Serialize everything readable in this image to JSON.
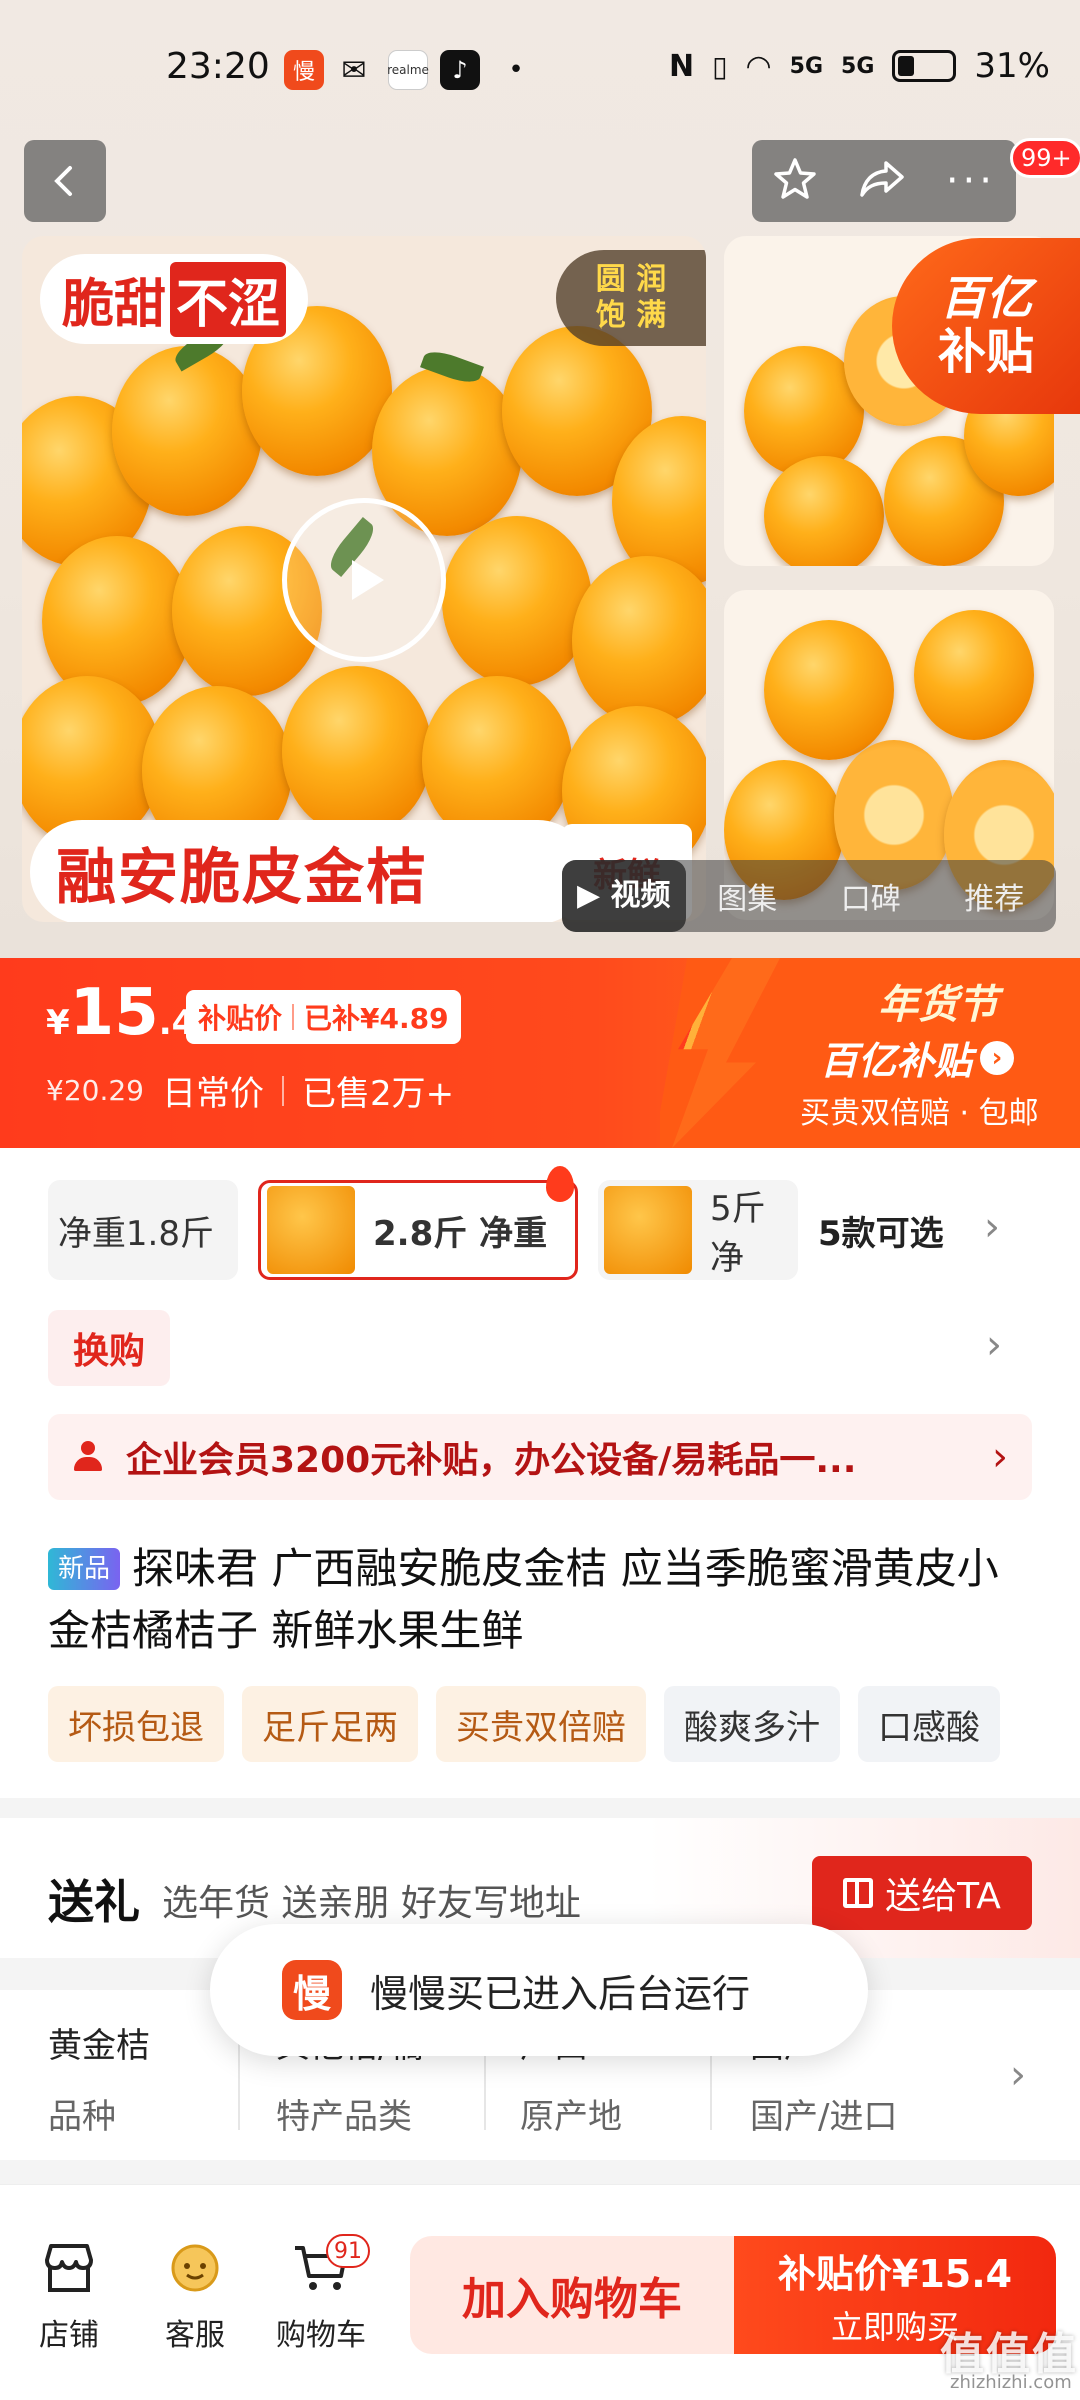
{
  "status_bar": {
    "time": "23:20",
    "app_badges": [
      "慢",
      "realme"
    ],
    "battery": "31%",
    "network": [
      "5G",
      "5G"
    ]
  },
  "topbar": {
    "back_icon": "chevron-left-icon",
    "badge_count": "99+"
  },
  "gallery": {
    "tag_left_a": "脆甜",
    "tag_left_b": "不涩",
    "tag_right_l1": "圆 润",
    "tag_right_l2": "饱 满",
    "banner": "融安脆皮金桔",
    "banner_tail": "新鲜",
    "corner_l1": "百亿",
    "corner_l2": "补贴",
    "tabs": [
      "视频",
      "图集",
      "口碑",
      "推荐"
    ],
    "active_tab": "视频"
  },
  "price": {
    "symbol": "¥",
    "integer": "15",
    "decimal": ".4",
    "tag_label": "补贴价",
    "tag_saved": "已补¥4.89",
    "original": "¥20.29",
    "daily_label": "日常价",
    "sold": "已售2万+"
  },
  "promo": {
    "festival": "年货节",
    "subsidy": "百亿补贴",
    "note": "买贵双倍赔 · 包邮"
  },
  "specs": {
    "options": [
      {
        "label": "净重1.8斤",
        "selected": false
      },
      {
        "label": "2.8斤 净重",
        "selected": true
      },
      {
        "label": "5斤 净",
        "selected": false
      }
    ],
    "count_label": "5款可选"
  },
  "exchange_label": "换购",
  "vip_text": "企业会员3200元补贴，办公设备/易耗品一...",
  "product": {
    "new_tag": "新品",
    "title": "探味君 广西融安脆皮金桔 应当季脆蜜滑黄皮小金桔橘桔子 新鲜水果生鲜"
  },
  "service_tags": [
    "坏损包退",
    "足斤足两",
    "买贵双倍赔",
    "酸爽多汁",
    "口感酸"
  ],
  "gift": {
    "title": "送礼",
    "subtitle": "选年货 送亲朋 好友写地址",
    "button": "送给TA"
  },
  "attributes": [
    {
      "value": "黄金桔",
      "key": "品种"
    },
    {
      "value": "其他桔/橘",
      "key": "特产品类"
    },
    {
      "value": "广西",
      "key": "原产地"
    },
    {
      "value": "国产",
      "key": "国产/进口"
    }
  ],
  "toast": {
    "icon_text": "慢",
    "text": "慢慢买已进入后台运行"
  },
  "bottom_nav": {
    "shop": "店铺",
    "service": "客服",
    "cart": "购物车",
    "cart_count": "91",
    "add_to_cart": "加入购物车",
    "buy_l1": "补贴价¥15.4",
    "buy_l2": "立即购买"
  },
  "watermark": {
    "main": "值值值",
    "sub": "zhizhizhi.com"
  },
  "colors": {
    "brand_red": "#e0261c",
    "price_orange": "#ff4a1c"
  }
}
